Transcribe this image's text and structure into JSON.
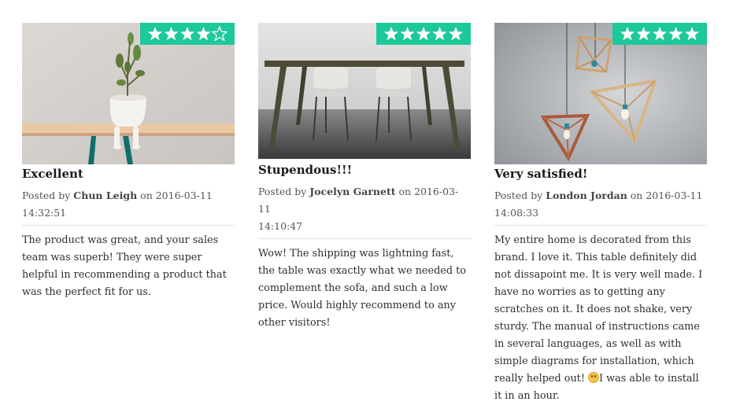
{
  "reviews": [
    {
      "title": "Excellent",
      "posted_by": "Posted by",
      "author": "Chun Leigh",
      "on": "on",
      "date": "2016-03-11",
      "time": "14:32:51",
      "rating": 4,
      "rating_max": 5,
      "photo": "plant-pot-on-wooden-shelf",
      "body": "The product was great, and your sales team was superb! They were super helpful in recommending a product that was the perfect fit for us."
    },
    {
      "title": "Stupendous!!!",
      "posted_by": "Posted by",
      "author": "Jocelyn Garnett",
      "on": "on",
      "date": "2016-03-11",
      "time": "14:10:47",
      "rating": 5,
      "rating_max": 5,
      "photo": "table-with-two-chairs",
      "body": "Wow! The shipping was lightning fast, the table was exactly what we needed to complement the sofa, and such a low price. Would highly recommend to any other visitors!"
    },
    {
      "title": "Very satisfied!",
      "posted_by": "Posted by",
      "author": "London Jordan",
      "on": "on",
      "date": "2016-03-11",
      "time": "14:08:33",
      "rating": 5,
      "rating_max": 5,
      "photo": "geometric-wooden-pendant-lamps",
      "body_before_emoji": "My entire home is decorated from this brand. I love it. This table definitely did not dissapoint me. It is very well made. I have no worries as to getting any scratches on it. It does not shake, very sturdy. The manual of instructions came in several languages, as well as with simple diagrams for installation, which really helped out! ",
      "emoji": "smiling-face-emoji",
      "body_after_emoji": "I was able to install it in an hour."
    }
  ],
  "colors": {
    "rating_badge": "#1dc99a",
    "star": "#ffffff",
    "title": "#1a1a1a",
    "text": "#2e2e2e",
    "divider": "#e2e2e2"
  }
}
